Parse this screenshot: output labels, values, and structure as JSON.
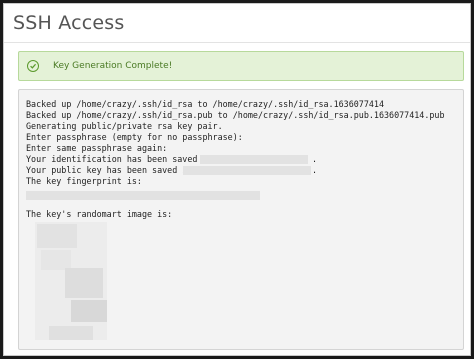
{
  "page": {
    "title": "SSH Access"
  },
  "alert": {
    "message": "Key Generation Complete!",
    "icon": "check-circle-icon",
    "color": "#5c9a2d"
  },
  "output": {
    "lines": [
      "Backed up /home/crazy/.ssh/id_rsa to /home/crazy/.ssh/id_rsa.1636077414",
      "Backed up /home/crazy/.ssh/id_rsa.pub to /home/crazy/.ssh/id_rsa.pub.1636077414.pub",
      "Generating public/private rsa key pair.",
      "Enter passphrase (empty for no passphrase):",
      "Enter same passphrase again:",
      "Your identification has been saved in",
      "Your public key has been saved in",
      "The key fingerprint is:",
      "",
      "The key's randomart image is:"
    ],
    "id_saved_suffix": ".",
    "pub_saved_suffix": "."
  }
}
